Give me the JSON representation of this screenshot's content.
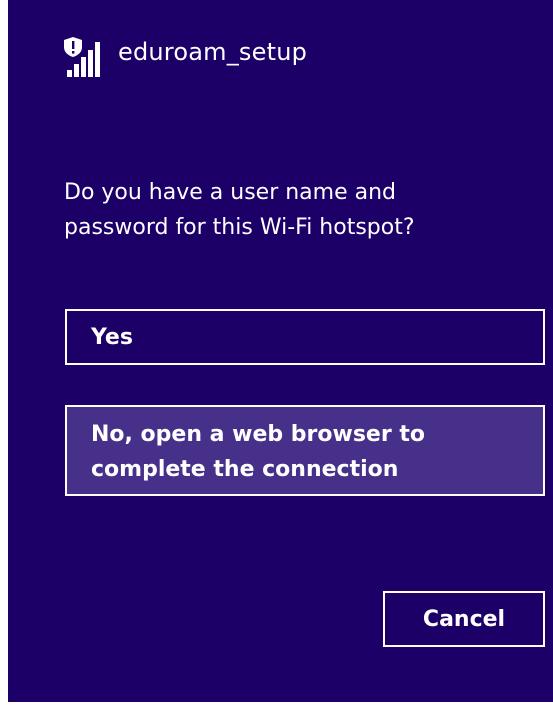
{
  "network": {
    "name": "eduroam_setup",
    "icon": "wifi-signal-shield-warning-icon"
  },
  "prompt": {
    "text": "Do you have a user name and password for this Wi-Fi hotspot?"
  },
  "options": {
    "yes_label": "Yes",
    "no_label": "No, open a web browser to complete the connection"
  },
  "actions": {
    "cancel_label": "Cancel"
  },
  "colors": {
    "panel_background": "#1c0068",
    "highlighted_option": "#47308a",
    "foreground": "#ffffff"
  }
}
